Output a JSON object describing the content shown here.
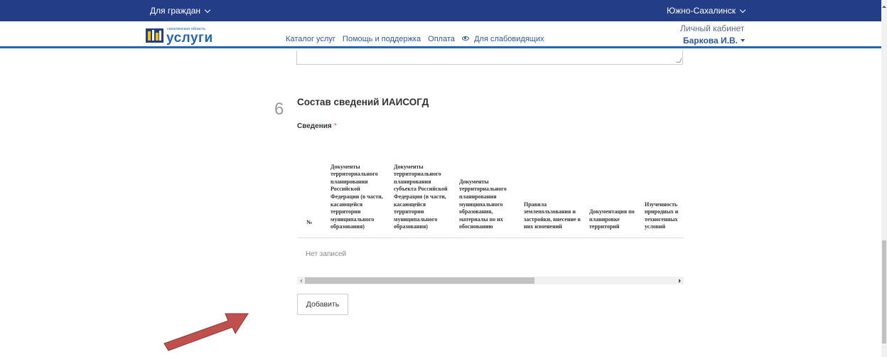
{
  "topbar": {
    "for_citizens": "Для граждан",
    "city": "Южно-Сахалинск"
  },
  "header": {
    "logo_small": "сахалинская область",
    "logo_big": "услуги",
    "nav": [
      "Каталог услуг",
      "Помощь и поддержка",
      "Оплата",
      "Для слабовидящих"
    ],
    "cabinet": "Личный кабинет",
    "user": "Баркова И.В."
  },
  "section": {
    "step": "6",
    "title": "Состав сведений ИАИСОГД",
    "field_label": "Сведения",
    "required_mark": "*"
  },
  "table": {
    "columns": [
      "№",
      "Документы территориального планирования Российской Федерации (в части, касающейся территории муниципального образования)",
      "Документы территориального планирования субъекта Российской Федерации (в части, касающейся территории муниципального образования)",
      "Документы территориального планирования муниципального образования, материалы по их обоснованию",
      "Правила землепользования и застройки, внесение в них изменений",
      "Документация по планировке территорий",
      "Изученность природных и техногенных условий"
    ],
    "empty_text": "Нет записей"
  },
  "buttons": {
    "add": "Добавить"
  },
  "colors": {
    "topbar": "#243d87",
    "accent": "#2566b0",
    "arrow": "#c0504d"
  }
}
